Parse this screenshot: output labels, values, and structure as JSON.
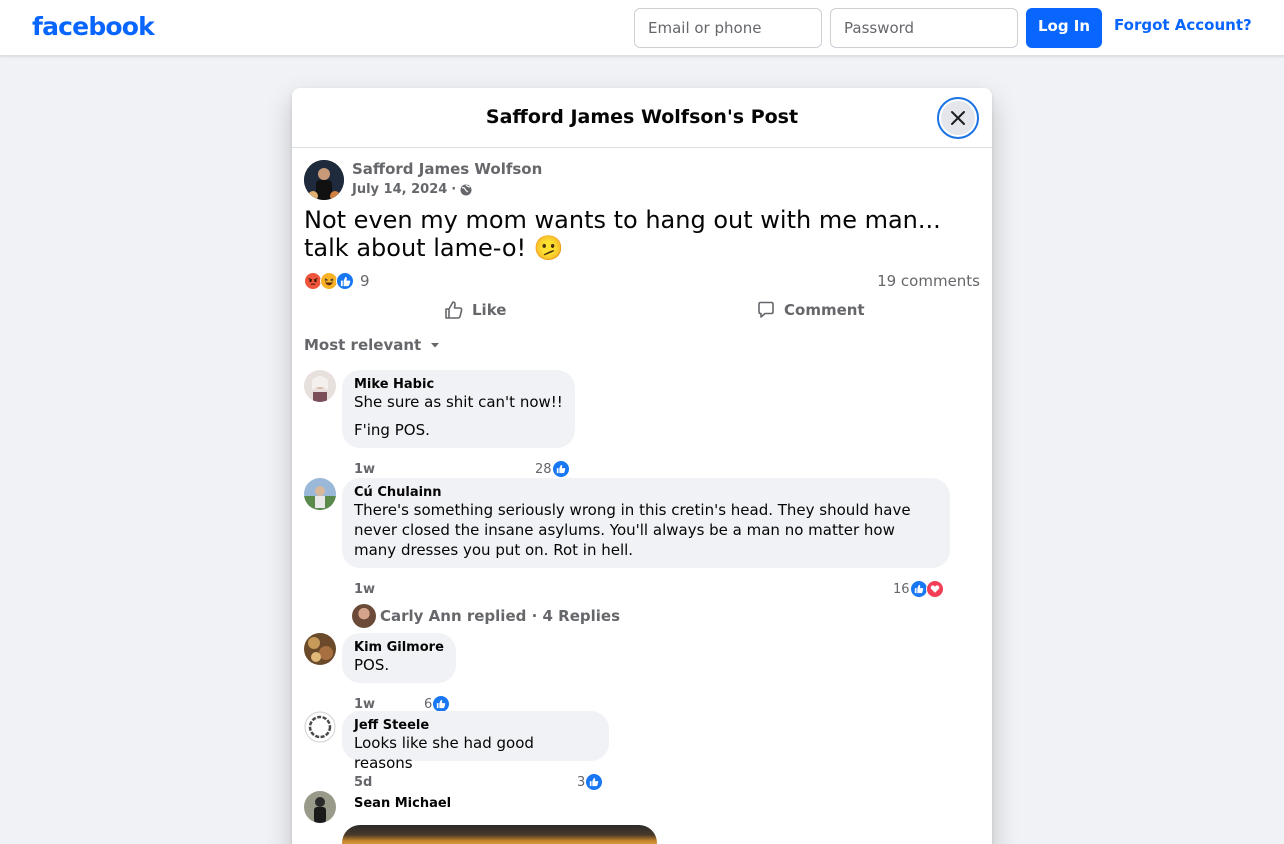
{
  "topbar": {
    "logo": "facebook",
    "email_placeholder": "Email or phone",
    "password_placeholder": "Password",
    "login_label": "Log In",
    "forgot_label": "Forgot Account?"
  },
  "modal": {
    "title": "Safford James Wolfson's Post"
  },
  "post": {
    "author": "Safford James Wolfson",
    "date": "July 14, 2024",
    "date_separator": "·",
    "text": "Not even my mom wants to hang out with me man... talk about lame-o! 🫤",
    "reaction_count": "9",
    "comments_count": "19 comments",
    "like_label": "Like",
    "comment_label": "Comment",
    "sort_label": "Most relevant"
  },
  "comments": [
    {
      "name": "Mike Habic",
      "lines": [
        "She sure as shit can't now!!",
        "F'ing POS."
      ],
      "time": "1w",
      "likes": "28"
    },
    {
      "name": "Cú Chulainn",
      "text": "There's something seriously wrong in this cretin's head. They should have never closed the insane asylums. You'll always be a man no matter how many dresses you put on. Rot in hell.",
      "time": "1w",
      "likes": "16",
      "replies": "Carly Ann replied · 4 Replies"
    },
    {
      "name": "Kim Gilmore",
      "text": "POS.",
      "time": "1w",
      "likes": "6"
    },
    {
      "name": "Jeff Steele",
      "text": "Looks like she had good reasons",
      "time": "5d",
      "likes": "3"
    },
    {
      "name": "Sean Michael"
    }
  ],
  "colors": {
    "brand": "#0866ff",
    "like_blue": "#1877f2",
    "heart_red": "#f33e58",
    "angry_orange": "#f0543c",
    "haha_yellow": "#f7b125"
  },
  "icons": [
    "globe-icon",
    "close-icon",
    "like-icon",
    "comment-icon",
    "chevron-down-icon",
    "angry-reaction-icon",
    "haha-reaction-icon",
    "like-reaction-icon",
    "heart-reaction-icon"
  ]
}
